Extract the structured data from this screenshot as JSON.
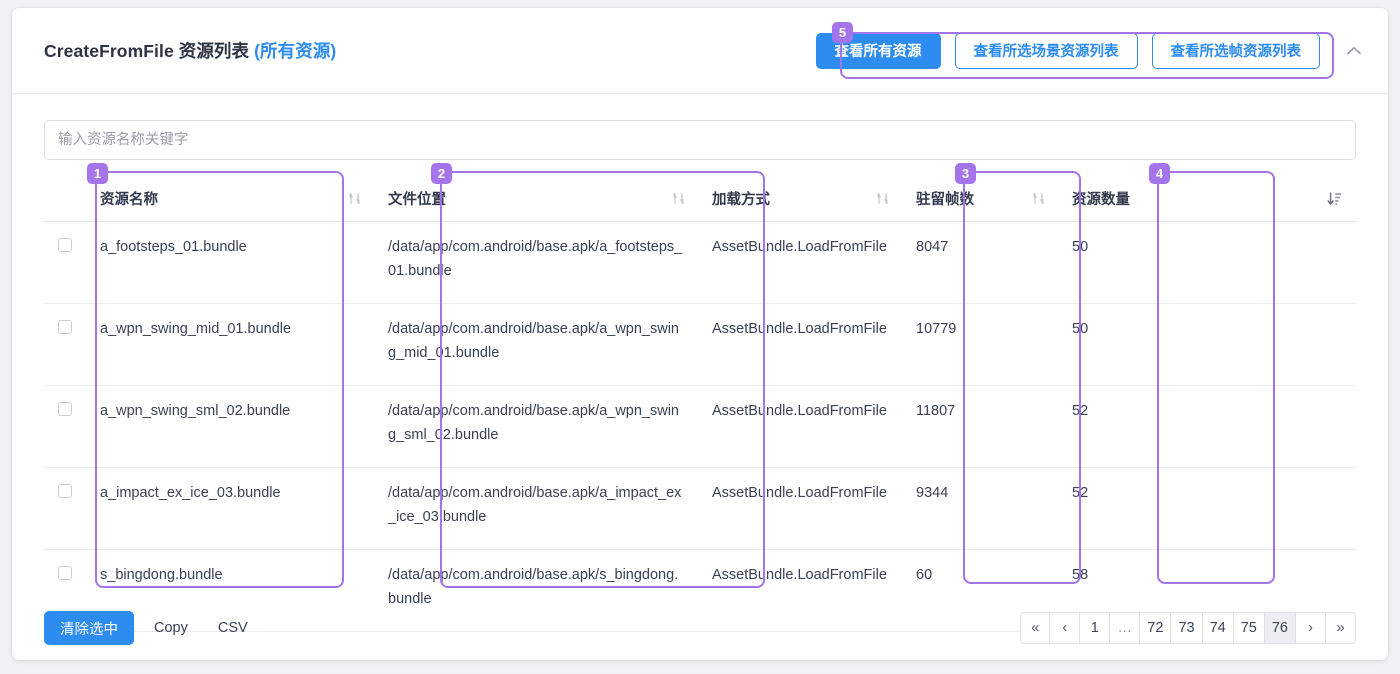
{
  "header": {
    "title_main": "CreateFromFile 资源列表",
    "title_suffix": "(所有资源)",
    "buttons": [
      {
        "label": "查看所有资源",
        "active": true
      },
      {
        "label": "查看所选场景资源列表",
        "active": false
      },
      {
        "label": "查看所选帧资源列表",
        "active": false
      }
    ],
    "collapse_icon": "chevron-up-icon"
  },
  "search": {
    "placeholder": "输入资源名称关键字",
    "value": ""
  },
  "table": {
    "columns": [
      {
        "key": "name",
        "label": "资源名称",
        "sort": "none"
      },
      {
        "key": "path",
        "label": "文件位置",
        "sort": "none"
      },
      {
        "key": "load",
        "label": "加载方式",
        "sort": "none"
      },
      {
        "key": "frame",
        "label": "驻留帧数",
        "sort": "none"
      },
      {
        "key": "count",
        "label": "资源数量",
        "sort": "none"
      },
      {
        "key": "extra",
        "label": "",
        "sort": "desc"
      }
    ],
    "rows": [
      {
        "checked": false,
        "name": "a_footsteps_01.bundle",
        "path": "/data/app/com.android/base.apk/a_footsteps_01.bundle",
        "load": "AssetBundle.LoadFromFile",
        "frame": "8047",
        "count": "50"
      },
      {
        "checked": false,
        "name": "a_wpn_swing_mid_01.bundle",
        "path": "/data/app/com.android/base.apk/a_wpn_swing_mid_01.bundle",
        "load": "AssetBundle.LoadFromFile",
        "frame": "10779",
        "count": "50"
      },
      {
        "checked": false,
        "name": "a_wpn_swing_sml_02.bundle",
        "path": "/data/app/com.android/base.apk/a_wpn_swing_sml_02.bundle",
        "load": "AssetBundle.LoadFromFile",
        "frame": "11807",
        "count": "52"
      },
      {
        "checked": false,
        "name": "a_impact_ex_ice_03.bundle",
        "path": "/data/app/com.android/base.apk/a_impact_ex_ice_03.bundle",
        "load": "AssetBundle.LoadFromFile",
        "frame": "9344",
        "count": "52"
      },
      {
        "checked": false,
        "name": "s_bingdong.bundle",
        "path": "/data/app/com.android/base.apk/s_bingdong.bundle",
        "load": "AssetBundle.LoadFromFile",
        "frame": "60",
        "count": "58"
      }
    ]
  },
  "footer": {
    "clear_label": "清除选中",
    "copy_label": "Copy",
    "csv_label": "CSV"
  },
  "pagination": {
    "first": "«",
    "prev": "‹",
    "next": "›",
    "last": "»",
    "pages": [
      "1",
      "…",
      "72",
      "73",
      "74",
      "75",
      "76"
    ],
    "active_page": "76"
  },
  "annotations": [
    {
      "num": "1",
      "target": "column-资源名称"
    },
    {
      "num": "2",
      "target": "column-文件位置"
    },
    {
      "num": "3",
      "target": "column-驻留帧数"
    },
    {
      "num": "4",
      "target": "column-资源数量"
    },
    {
      "num": "5",
      "target": "header-button-group"
    }
  ],
  "colors": {
    "accent": "#2d8cf0",
    "annotation": "#a474ea",
    "text": "#2c3345",
    "page_bg": "#f2f2f4"
  }
}
